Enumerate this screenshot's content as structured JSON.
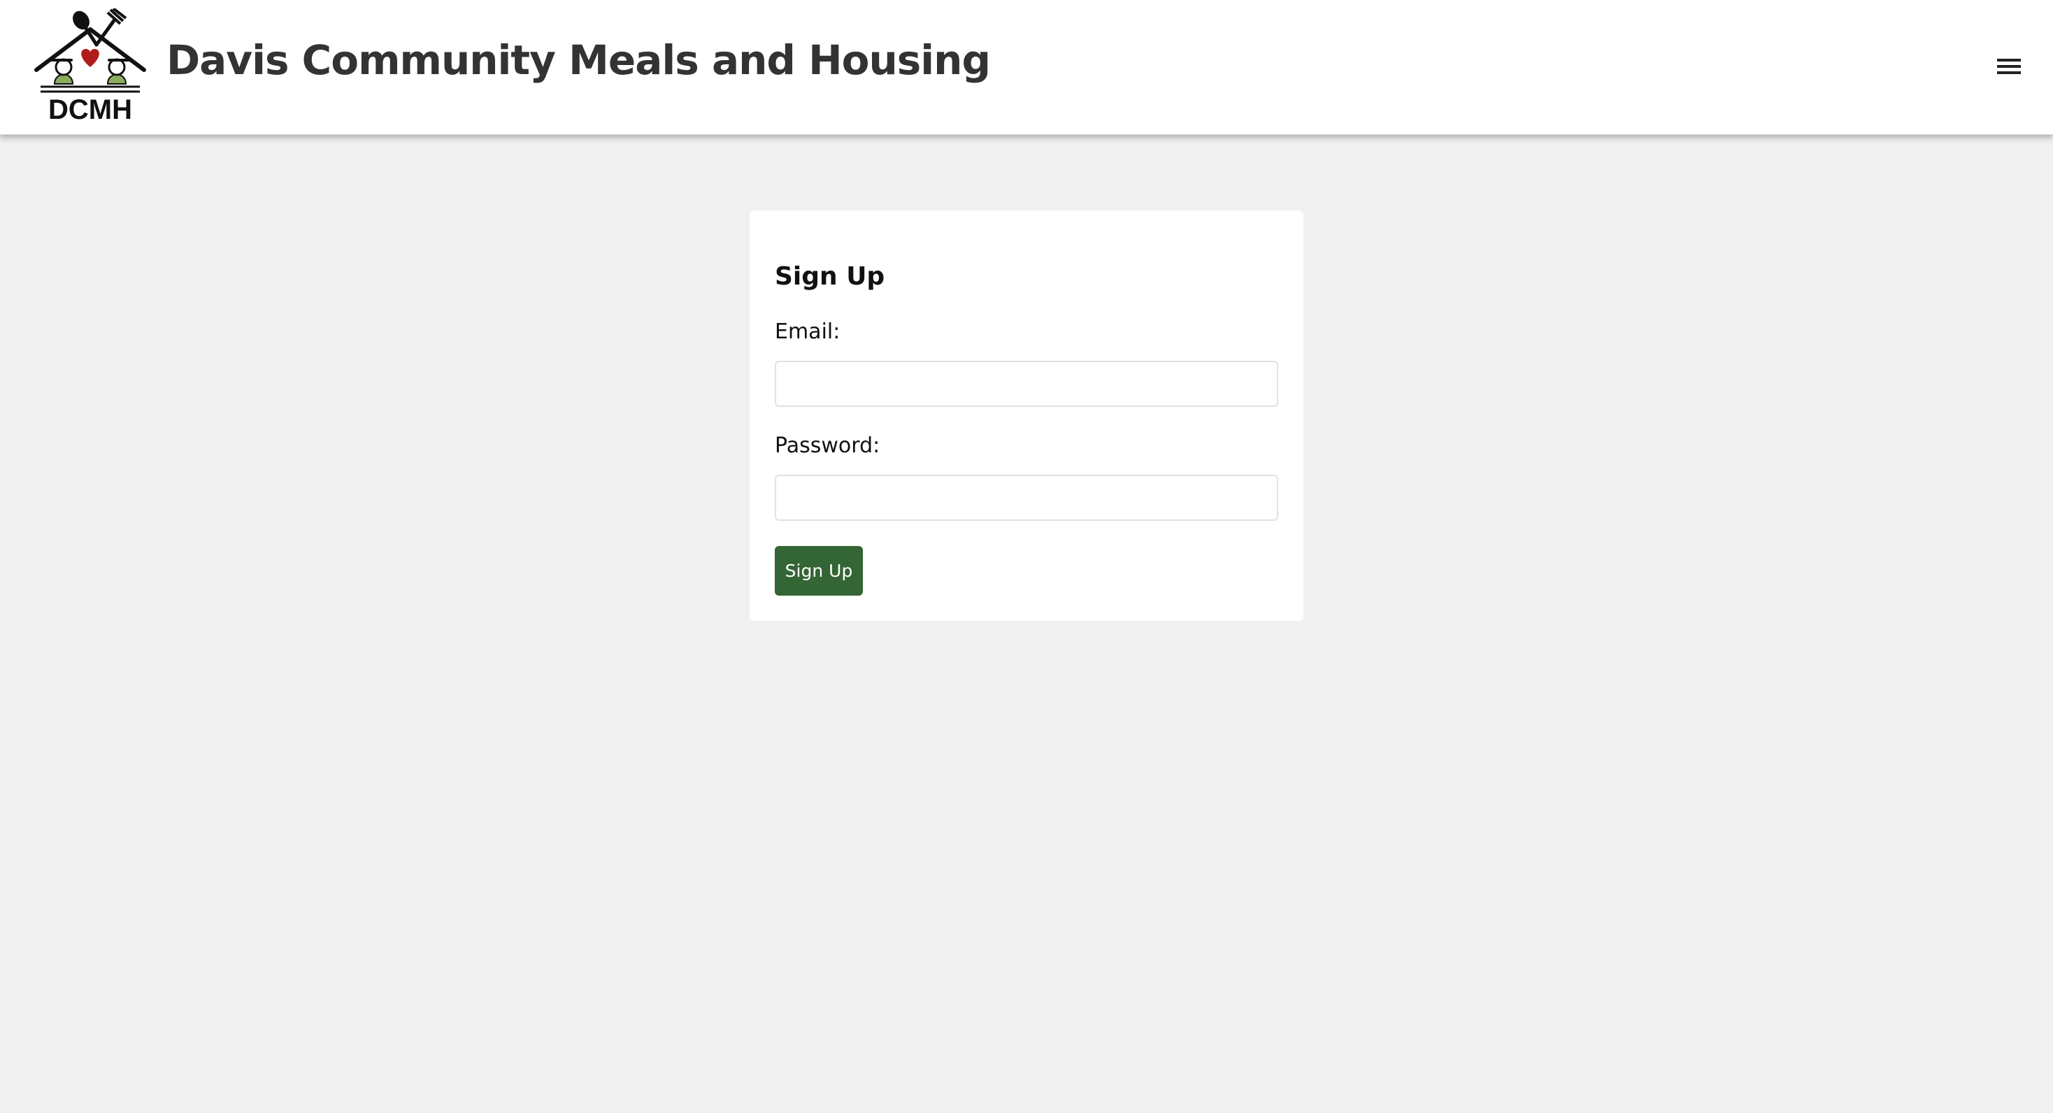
{
  "header": {
    "logo_text": "DCMH",
    "site_title": "Davis Community Meals and Housing",
    "menu_icon": "hamburger-menu-icon"
  },
  "signup_form": {
    "title": "Sign Up",
    "email_label": "Email:",
    "email_value": "",
    "password_label": "Password:",
    "password_value": "",
    "submit_label": "Sign Up"
  },
  "colors": {
    "page_background": "#f0f0f0",
    "header_background": "#ffffff",
    "title_text": "#333333",
    "button_green": "#346534",
    "logo_heart": "#b01c1c",
    "logo_figures": "#8aac5c"
  }
}
